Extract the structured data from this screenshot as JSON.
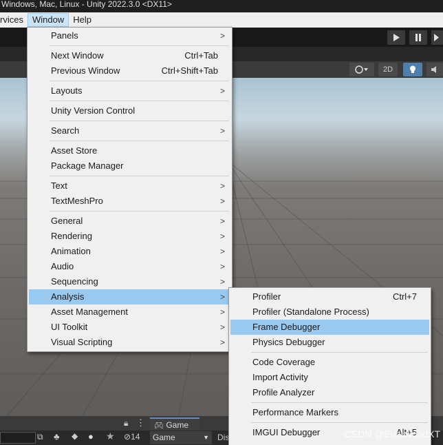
{
  "window": {
    "title": "Windows, Mac, Linux - Unity 2022.3.0 <DX11>"
  },
  "menubar": {
    "items": [
      {
        "label": "rvices"
      },
      {
        "label": "Window"
      },
      {
        "label": "Help"
      }
    ]
  },
  "toolbar": {
    "play_icon": "play-icon",
    "pause_icon": "pause-icon",
    "step_icon": "step-icon"
  },
  "scene_toolbar": {
    "mode_2d": "2D"
  },
  "window_menu": {
    "items": [
      {
        "label": "Panels",
        "submenu": true
      },
      {
        "label": "Next Window",
        "shortcut": "Ctrl+Tab"
      },
      {
        "label": "Previous Window",
        "shortcut": "Ctrl+Shift+Tab"
      },
      {
        "label": "Layouts",
        "submenu": true
      },
      {
        "label": "Unity Version Control"
      },
      {
        "label": "Search",
        "submenu": true
      },
      {
        "label": "Asset Store"
      },
      {
        "label": "Package Manager"
      },
      {
        "label": "Text",
        "submenu": true
      },
      {
        "label": "TextMeshPro",
        "submenu": true
      },
      {
        "label": "General",
        "submenu": true
      },
      {
        "label": "Rendering",
        "submenu": true
      },
      {
        "label": "Animation",
        "submenu": true
      },
      {
        "label": "Audio",
        "submenu": true
      },
      {
        "label": "Sequencing",
        "submenu": true
      },
      {
        "label": "Analysis",
        "submenu": true,
        "highlighted": true
      },
      {
        "label": "Asset Management",
        "submenu": true
      },
      {
        "label": "UI Toolkit",
        "submenu": true
      },
      {
        "label": "Visual Scripting",
        "submenu": true
      }
    ]
  },
  "analysis_menu": {
    "items": [
      {
        "label": "Profiler",
        "shortcut": "Ctrl+7"
      },
      {
        "label": "Profiler (Standalone Process)"
      },
      {
        "label": "Frame Debugger",
        "highlighted": true
      },
      {
        "label": "Physics Debugger"
      },
      {
        "label": "Code Coverage"
      },
      {
        "label": "Import Activity"
      },
      {
        "label": "Profile Analyzer"
      },
      {
        "label": "Performance Markers"
      },
      {
        "label": "IMGUI Debugger",
        "shortcut": "Alt+5"
      }
    ]
  },
  "bottom": {
    "game_tab": "Game",
    "game_dropdown": "Game",
    "hidden_count": "14",
    "display_partial": "Dis"
  },
  "watermark": "CSDN @EucliwoodXT",
  "colors": {
    "highlight": "#99c9ef",
    "menu_bg": "#f0f0f0",
    "editor_dark": "#3c3c3c"
  }
}
